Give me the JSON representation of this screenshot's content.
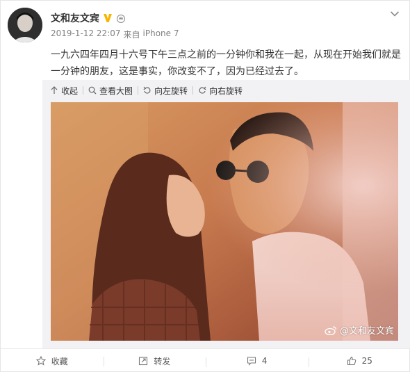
{
  "author": {
    "name": "文和友文宾",
    "verified_badge": "V",
    "time": "2019-1-12 22:07",
    "source_prefix": "来自",
    "source": "iPhone 7"
  },
  "post": {
    "text": "一九六四年四月十六号下午三点之前的一分钟你和我在一起，从现在开始我们就是一分钟的朋友，这是事实，你改变不了，因为已经过去了。"
  },
  "media_toolbar": {
    "collapse": "收起",
    "view_large": "查看大图",
    "rotate_left": "向左旋转",
    "rotate_right": "向右旋转"
  },
  "photo": {
    "watermark": "@文和友文宾"
  },
  "actions": {
    "favorite": "收藏",
    "repost": "转发",
    "comment_count": "4",
    "like_count": "25"
  },
  "colors": {
    "badge": "#f7b500",
    "link": "#eb7350",
    "meta": "#808080"
  }
}
